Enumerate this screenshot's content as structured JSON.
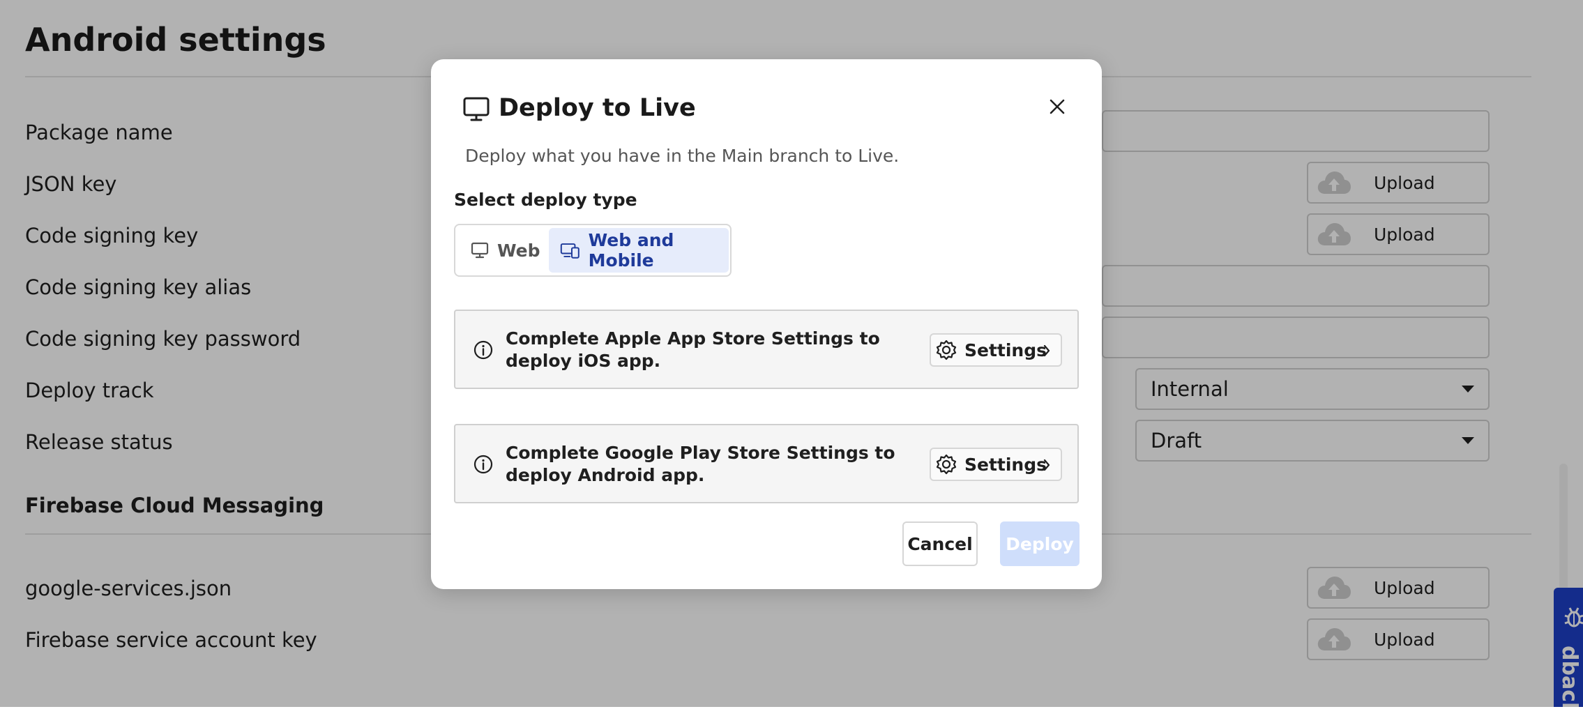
{
  "page": {
    "title": "Android settings",
    "rows": [
      {
        "label": "Package name"
      },
      {
        "label": "JSON key",
        "action": "Upload"
      },
      {
        "label": "Code signing key",
        "action": "Upload"
      },
      {
        "label": "Code signing key alias"
      },
      {
        "label": "Code signing key password"
      },
      {
        "label": "Deploy track",
        "value": "Internal"
      },
      {
        "label": "Release status",
        "value": "Draft"
      }
    ],
    "firebase": {
      "heading": "Firebase Cloud Messaging",
      "rows": [
        {
          "label": "google-services.json",
          "action": "Upload"
        },
        {
          "label": "Firebase service account key",
          "action": "Upload"
        }
      ]
    }
  },
  "feedback_tab": {
    "label": "dback"
  },
  "modal": {
    "title": "Deploy to Live",
    "description": "Deploy what you have in the Main branch to Live.",
    "deploy_type_label": "Select deploy type",
    "deploy_types": [
      {
        "label": "Web",
        "selected": false
      },
      {
        "label": "Web and Mobile",
        "selected": true
      }
    ],
    "notices": [
      {
        "text": "Complete Apple App Store Settings to deploy iOS app.",
        "button": "Settings"
      },
      {
        "text": "Complete Google Play Store Settings to deploy Android app.",
        "button": "Settings"
      }
    ],
    "cancel_label": "Cancel",
    "deploy_label": "Deploy"
  },
  "colors": {
    "accent": "#1e40c8",
    "selected_bg": "#e6ecfb",
    "selected_text": "#1e3a9a",
    "deploy_disabled": "#cfdefb"
  },
  "icons": [
    "monitor-icon",
    "close-icon",
    "devices-icon",
    "info-icon",
    "gear-icon",
    "chevron-right-icon",
    "cloud-upload-icon",
    "caret-down-icon",
    "bug-icon"
  ]
}
